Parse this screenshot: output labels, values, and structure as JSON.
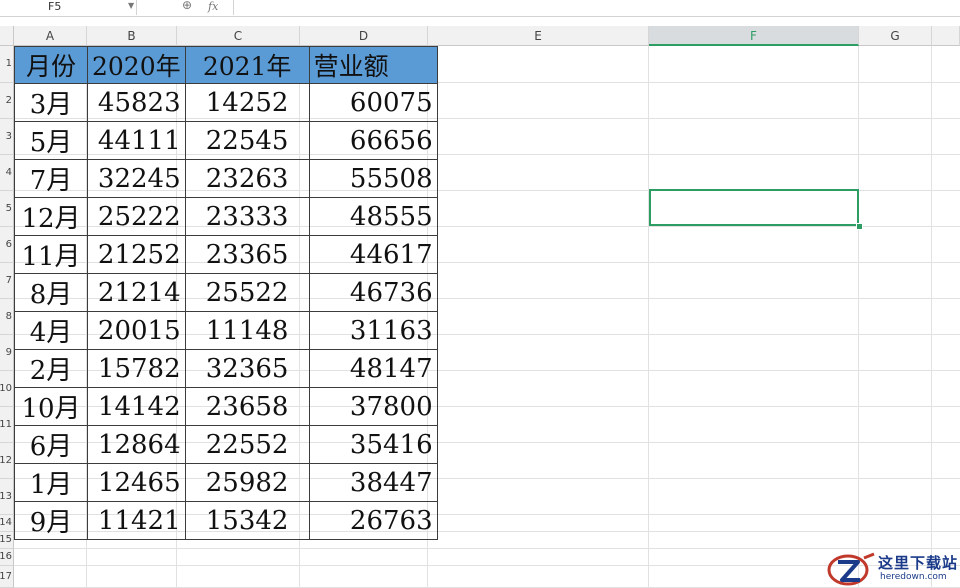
{
  "formula_bar": {
    "cell_ref": "F5",
    "fx_label": "fx",
    "zoom_icon": "zoom-icon",
    "dropdown_icon": "chevron-down-icon"
  },
  "columns": [
    "A",
    "B",
    "C",
    "D",
    "E",
    "F",
    "G"
  ],
  "selected_column": "F",
  "rows": [
    "1",
    "2",
    "3",
    "4",
    "5",
    "6",
    "7",
    "8",
    "9",
    "10",
    "11",
    "12",
    "13",
    "14",
    "15",
    "16",
    "17"
  ],
  "table": {
    "header": [
      "月份",
      "2020年",
      "2021年",
      "营业额"
    ],
    "rows": [
      [
        "3月",
        "45823",
        "14252",
        "60075"
      ],
      [
        "5月",
        "44111",
        "22545",
        "66656"
      ],
      [
        "7月",
        "32245",
        "23263",
        "55508"
      ],
      [
        "12月",
        "25222",
        "23333",
        "48555"
      ],
      [
        "11月",
        "21252",
        "23365",
        "44617"
      ],
      [
        "8月",
        "21214",
        "25522",
        "46736"
      ],
      [
        "4月",
        "20015",
        "11148",
        "31163"
      ],
      [
        "2月",
        "15782",
        "32365",
        "48147"
      ],
      [
        "10月",
        "14142",
        "23658",
        "37800"
      ],
      [
        "6月",
        "12864",
        "22552",
        "35416"
      ],
      [
        "1月",
        "12465",
        "25982",
        "38447"
      ],
      [
        "9月",
        "11421",
        "15342",
        "26763"
      ]
    ]
  },
  "colors": {
    "header_fill": "#5b9bd5",
    "selection": "#2e9d63",
    "watermark": "#1b3b8a"
  },
  "watermark": {
    "title": "这里下载站",
    "url": "heredown.com"
  }
}
